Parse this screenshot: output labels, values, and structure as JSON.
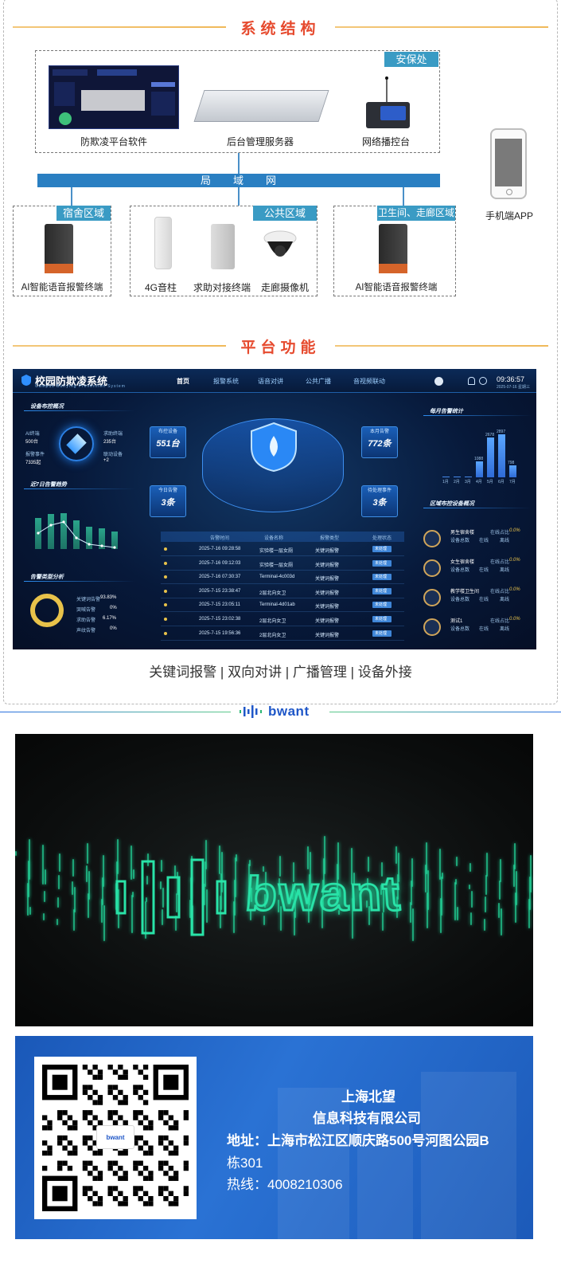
{
  "section_system": {
    "title": "系统结构"
  },
  "diagram": {
    "security_tag": "安保处",
    "software_label": "防欺凌平台软件",
    "server_label": "后台管理服务器",
    "console_label": "网络播控台",
    "lan_chars": [
      "局",
      "域",
      "网"
    ],
    "phone_label": "手机端APP",
    "dorm_tag": "宿舍区域",
    "dorm_device": "AI智能语音报警终端",
    "public_tag": "公共区域",
    "public_devices": [
      "4G音柱",
      "求助对接终端",
      "走廊摄像机"
    ],
    "wc_tag": "卫生间、走廊区域",
    "wc_device": "AI智能语音报警终端"
  },
  "section_platform": {
    "title": "平台功能"
  },
  "dashboard": {
    "title": "校园防欺凌系统",
    "subtitle": "Campus Bullying Prevention System",
    "nav": [
      "首页",
      "报警系统",
      "语音对讲",
      "公共广播",
      "音视频联动"
    ],
    "clock": "09:36:57",
    "date": "2025-07-16 星期三",
    "panel_device_overview": "设备布控概况",
    "device_stats": [
      {
        "label": "AI终端",
        "value": "500台"
      },
      {
        "label": "求助终端",
        "value": "235台"
      },
      {
        "label": "报警事件",
        "value": "7335起"
      },
      {
        "label": "联动设备",
        "value": "+2"
      }
    ],
    "panel_week_trend": "近7日告警趋势",
    "panel_type_analysis": "告警类型分析",
    "type_stats": [
      {
        "label": "关键词告警",
        "value": "93.83%"
      },
      {
        "label": "哭喊告警",
        "value": "0%"
      },
      {
        "label": "求助告警",
        "value": "6.17%"
      },
      {
        "label": "声纹告警",
        "value": "0%"
      }
    ],
    "cards": [
      {
        "label": "布控设备",
        "value": "551台"
      },
      {
        "label": "本月告警",
        "value": "772条"
      },
      {
        "label": "今日告警",
        "value": "3条"
      },
      {
        "label": "待处理事件",
        "value": "3条"
      }
    ],
    "table_head": [
      "告警时间",
      "设备名称",
      "报警类型",
      "处理状态"
    ],
    "rows": [
      {
        "time": "2025-7-16 09:28:58",
        "device": "实验楼一层女厕",
        "type": "关键词报警"
      },
      {
        "time": "2025-7-16 09:12:03",
        "device": "实验楼一层女厕",
        "type": "关键词报警"
      },
      {
        "time": "2025-7-16 07:30:37",
        "device": "Terminal-4c003d",
        "type": "关键词报警"
      },
      {
        "time": "2025-7-15 23:38:47",
        "device": "2层北向女卫",
        "type": "关键词报警"
      },
      {
        "time": "2025-7-15 23:05:11",
        "device": "Terminal-4d01ab",
        "type": "关键词报警"
      },
      {
        "time": "2025-7-15 23:02:38",
        "device": "2层北向女卫",
        "type": "关键词报警"
      },
      {
        "time": "2025-7-15 19:56:36",
        "device": "2层北向女卫",
        "type": "关键词报警"
      }
    ],
    "row_button": "未处理",
    "panel_month_stats": "每月告警统计",
    "month_values": [
      0,
      0,
      0,
      1088,
      2678,
      2897,
      798
    ],
    "month_labels": [
      "1月",
      "2月",
      "3月",
      "4月",
      "5月",
      "6月",
      "7月"
    ],
    "panel_region": "区域布控设备概况",
    "regions": [
      {
        "name": "男生宿舍楼",
        "rate": "0.0%"
      },
      {
        "name": "女生宿舍楼",
        "rate": "0.0%"
      },
      {
        "name": "教学楼卫生间",
        "rate": "0.0%"
      },
      {
        "name": "测试1",
        "rate": "0.0%"
      }
    ],
    "region_fields": [
      "设备总数",
      "在线",
      "离线"
    ],
    "online_label": "在线占比",
    "week_values": [
      62,
      70,
      72,
      58,
      45,
      42,
      35
    ]
  },
  "features_line": "关键词报警  |  双向对讲  |  广播管理  |  设备外接",
  "brand": {
    "name": "bwant"
  },
  "contact": {
    "company_line1": "上海北望",
    "company_line2": "信息科技有限公司",
    "address_line1": "地址：上海市松江区顺庆路500号河图公园B",
    "address_line2": "栋301",
    "hotline": "热线：4008210306",
    "qr_logo": "bwant"
  },
  "colors": {
    "accent_red": "#e64a2e",
    "tag_blue": "#3a9bc4",
    "lan_blue": "#2a7fc2",
    "contact_blue": "#2a72d4",
    "neon_green": "#29e3a8"
  }
}
